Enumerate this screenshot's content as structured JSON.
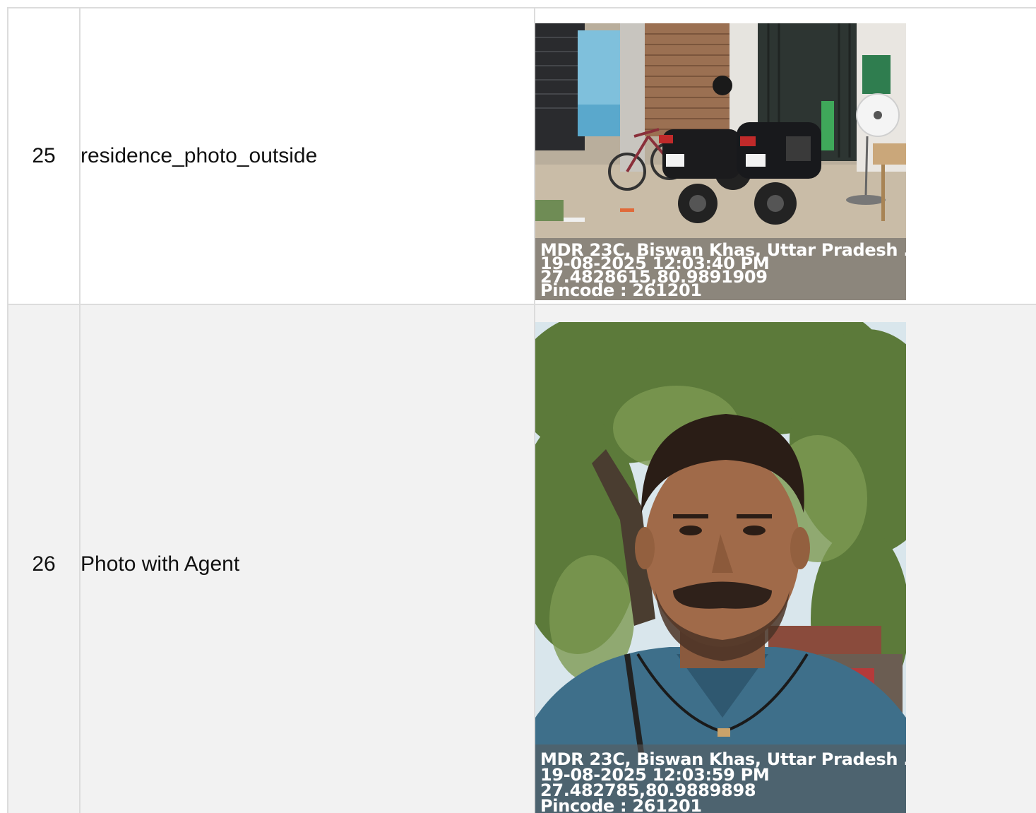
{
  "rows": [
    {
      "number": "25",
      "label": "residence_photo_outside",
      "photo": {
        "subject": "motorcycles-parked-outside-shop",
        "stamp": {
          "address": "MDR 23C, Biswan Khas, Uttar Pradesh ...",
          "datetime": "19-08-2025 12:03:40 PM",
          "coords": "27.4828615,80.9891909",
          "pincode": "Pincode : 261201"
        }
      }
    },
    {
      "number": "26",
      "label": "Photo with Agent",
      "photo": {
        "subject": "selfie-under-tree",
        "stamp": {
          "address": "MDR 23C, Biswan Khas, Uttar Pradesh ...",
          "datetime": "19-08-2025 12:03:59 PM",
          "coords": "27.482785,80.9889898",
          "pincode": "Pincode : 261201"
        }
      }
    }
  ],
  "colors": {
    "border": "#dcdcdc",
    "row_alt_background": "#f2f2f2",
    "stamp_overlay": "#5a5a5a"
  }
}
